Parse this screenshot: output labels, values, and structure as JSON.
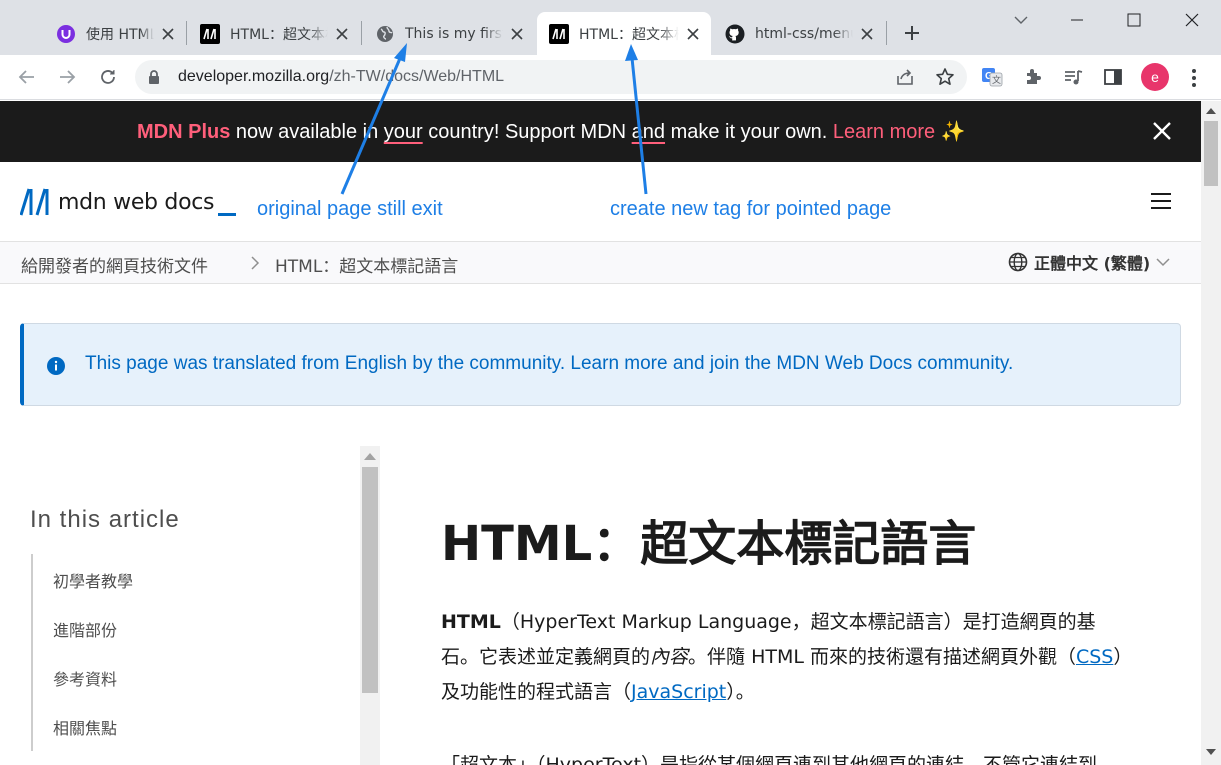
{
  "browser": {
    "tabs": [
      {
        "title": "使用 HTML 和 CSS",
        "favicon": "u-circle-icon"
      },
      {
        "title": "HTML：超文本標記語言",
        "favicon": "mdn-icon"
      },
      {
        "title": "This is my first web page",
        "favicon": "globe-icon"
      },
      {
        "title": "HTML：超文本標記語言",
        "favicon": "mdn-icon",
        "active": true
      },
      {
        "title": "html-css/menu",
        "favicon": "github-icon"
      }
    ],
    "url_host": "developer.mozilla.org",
    "url_path": "/zh-TW/docs/Web/HTML",
    "profile_initial": "e",
    "colors": {
      "tabstrip": "#dee1e6",
      "avatar": "#e8356b"
    }
  },
  "banner": {
    "brand": "MDN Plus",
    "part1": " now available in ",
    "your": "your",
    "part2": " country! Support MDN ",
    "and": "and",
    "part3": " make it your own. ",
    "learn_more": "Learn more",
    "sparkle": "✨"
  },
  "header": {
    "logo_text": "mdn web docs"
  },
  "breadcrumb": {
    "root": "給開發者的網頁技術文件",
    "current": "HTML：超文本標記語言",
    "language": "正體中文 (繁體)"
  },
  "notice": {
    "text": "This page was translated from English by the community. Learn more and join the MDN Web Docs community."
  },
  "toc": {
    "heading": "In this article",
    "items": [
      "初學者教學",
      "進階部份",
      "參考資料",
      "相關焦點"
    ]
  },
  "article": {
    "title": "HTML：超文本標記語言",
    "p1_bold": "HTML",
    "p1_a": "（HyperText Markup Language，超文本標記語言）是打造網頁的基石。它表述並定義網頁的",
    "p1_em": "內容",
    "p1_b": "。伴隨 HTML 而來的技術還有描述網頁外觀（",
    "link_css": "CSS",
    "p1_c": "）及功能性的程式語言（",
    "link_js": "JavaScript",
    "p1_d": "）。",
    "p2": "「超文本」（HyperText）是指從某個網頁連到其他網頁的連結，不管它連結到"
  },
  "annotations": {
    "left": "original page still exit",
    "right": "create new tag for pointed page",
    "color": "#1e7fe6"
  }
}
